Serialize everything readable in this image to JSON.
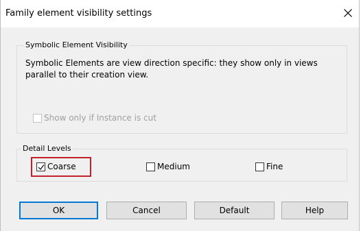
{
  "window": {
    "title": "Family element visibility settings",
    "close_icon": "close-icon"
  },
  "symbolic": {
    "group_label": "Symbolic Element Visibility",
    "description_line1": "Symbolic Elements are view direction specific: they show only in views",
    "description_line2": "parallel to their creation view.",
    "show_if_cut": {
      "label": "Show only if Instance is cut",
      "checked": false,
      "enabled": false
    }
  },
  "detail_levels": {
    "group_label": "Detail Levels",
    "coarse": {
      "label": "Coarse",
      "checked": true
    },
    "medium": {
      "label": "Medium",
      "checked": false
    },
    "fine": {
      "label": "Fine",
      "checked": false
    }
  },
  "buttons": {
    "ok": "OK",
    "cancel": "Cancel",
    "default": "Default",
    "help": "Help"
  },
  "colors": {
    "highlight_border": "#c0202a",
    "default_button_border": "#0078d7"
  }
}
